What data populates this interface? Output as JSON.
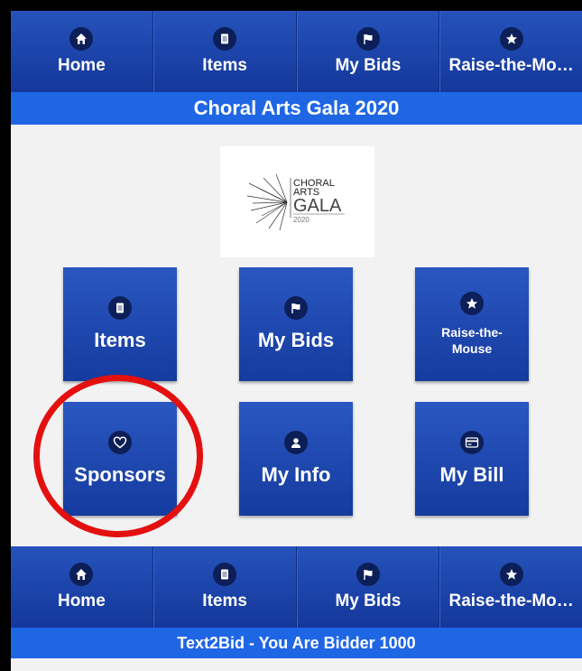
{
  "top_nav": {
    "tabs": [
      {
        "label": "Home",
        "icon": "home-icon"
      },
      {
        "label": "Items",
        "icon": "document-icon"
      },
      {
        "label": "My Bids",
        "icon": "flag-icon"
      },
      {
        "label": "Raise-the-Mo…",
        "icon": "star-icon"
      }
    ]
  },
  "event_title": "Choral Arts Gala 2020",
  "logo": {
    "line1": "CHORAL",
    "line2": "ARTS",
    "line3": "GALA",
    "line4": "2020"
  },
  "tiles": [
    {
      "label": "Items",
      "icon": "document-icon"
    },
    {
      "label": "My Bids",
      "icon": "flag-icon"
    },
    {
      "label": "Raise-the-Mouse",
      "icon": "star-icon"
    },
    {
      "label": "Sponsors",
      "icon": "heart-icon"
    },
    {
      "label": "My Info",
      "icon": "person-icon"
    },
    {
      "label": "My Bill",
      "icon": "credit-card-icon"
    }
  ],
  "bottom_nav": {
    "tabs": [
      {
        "label": "Home",
        "icon": "home-icon"
      },
      {
        "label": "Items",
        "icon": "document-icon"
      },
      {
        "label": "My Bids",
        "icon": "flag-icon"
      },
      {
        "label": "Raise-the-Mo…",
        "icon": "star-icon"
      }
    ]
  },
  "bidder_banner": "Text2Bid - You Are Bidder 1000",
  "colors": {
    "nav_blue": "#14379b",
    "title_blue": "#1f66e5",
    "highlight_red": "#e41010"
  }
}
